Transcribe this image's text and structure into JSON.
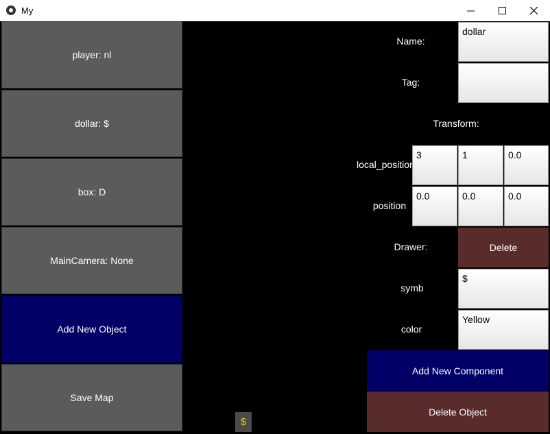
{
  "window": {
    "title": "My"
  },
  "objects": {
    "items": [
      "player: nl",
      "dollar: $",
      "box: D",
      "MainCamera: None"
    ],
    "add_label": "Add New Object",
    "save_label": "Save Map"
  },
  "inspector": {
    "name_label": "Name:",
    "name_value": "dollar",
    "tag_label": "Tag:",
    "tag_value": "",
    "transform_label": "Transform:",
    "local_position_label": "local_position",
    "local_position": [
      "3",
      "1",
      "0.0"
    ],
    "position_label": "position",
    "position": [
      "0.0",
      "0.0",
      "0.0"
    ],
    "drawer_label": "Drawer:",
    "delete_label": "Delete",
    "symb_label": "symb",
    "symb_value": "$",
    "color_label": "color",
    "color_value": "Yellow",
    "add_component_label": "Add New Component",
    "delete_object_label": "Delete Object"
  },
  "scene": {
    "dollar_glyph": "$",
    "glyph_color": "#e5d500"
  },
  "colors": {
    "navy": "#000066",
    "maroon": "#5a2b2b",
    "gray": "#5b5b5b"
  }
}
